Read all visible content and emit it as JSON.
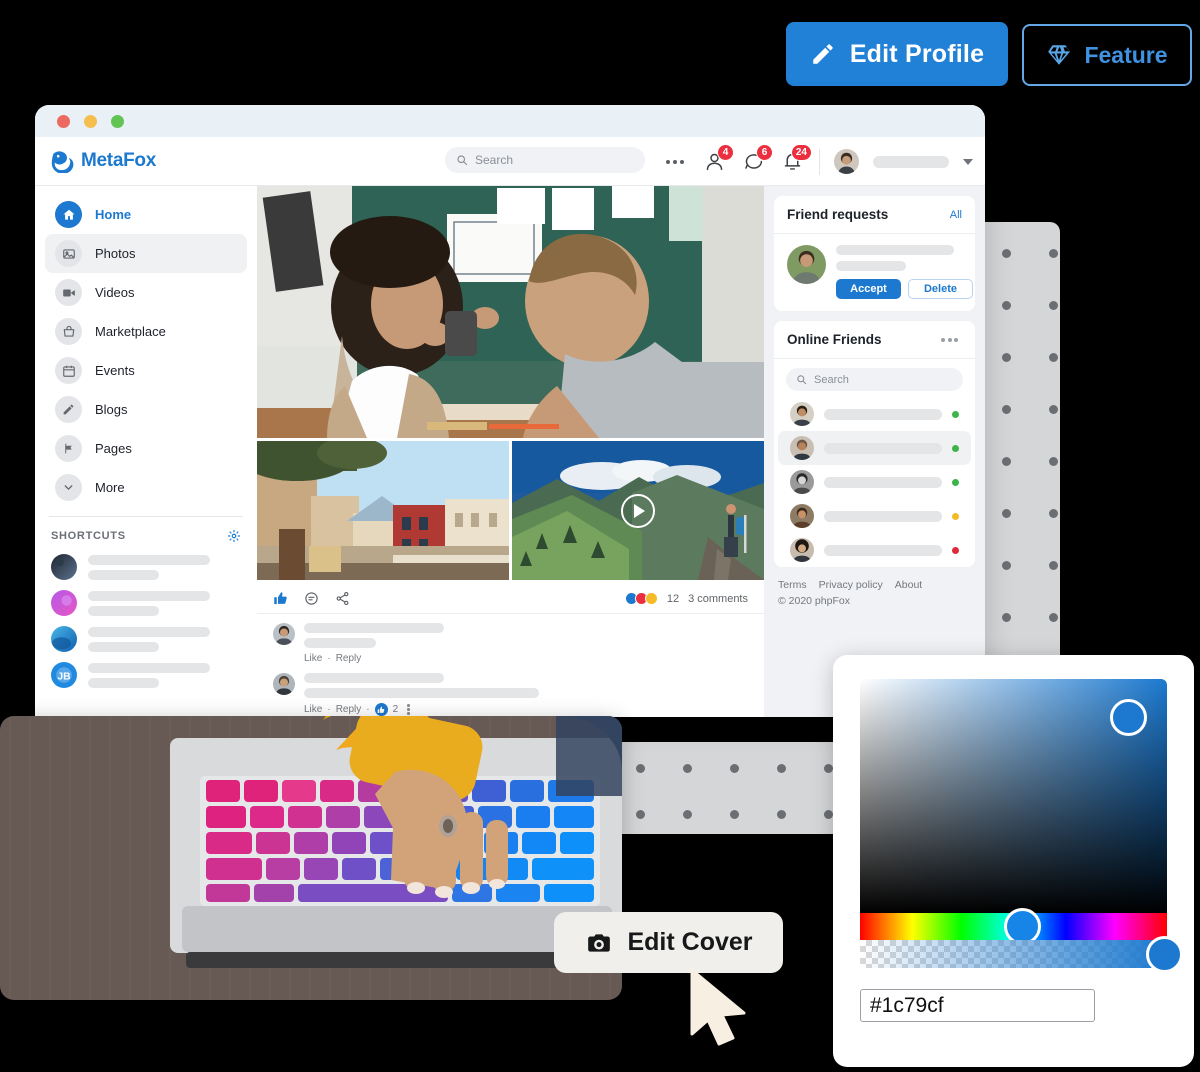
{
  "top_actions": {
    "edit_profile": {
      "label": "Edit Profile",
      "icon": "pencil-icon",
      "color": "#2081d6"
    },
    "feature": {
      "label": "Feature",
      "icon": "diamond-icon",
      "color": "#3f92e0"
    }
  },
  "window": {
    "traffic_lights": [
      "close",
      "minimize",
      "maximize"
    ]
  },
  "appbar": {
    "brand": "MetaFox",
    "brand_color": "#1c79cf",
    "search": {
      "placeholder": "Search",
      "icon": "search-icon"
    },
    "more_icon": "ellipsis-icon",
    "icons": [
      {
        "name": "friends-icon",
        "badge": "4"
      },
      {
        "name": "messages-icon",
        "badge": "6"
      },
      {
        "name": "notifications-icon",
        "badge": "24"
      }
    ],
    "account": {
      "avatar": "user-avatar",
      "caret": "chevron-down-icon"
    }
  },
  "sidebar": {
    "items": [
      {
        "label": "Home",
        "icon": "home-icon",
        "active": true
      },
      {
        "label": "Photos",
        "icon": "photo-icon",
        "highlighted": true
      },
      {
        "label": "Videos",
        "icon": "video-icon"
      },
      {
        "label": "Marketplace",
        "icon": "shop-icon"
      },
      {
        "label": "Events",
        "icon": "calendar-icon"
      },
      {
        "label": "Blogs",
        "icon": "pencil-icon"
      },
      {
        "label": "Pages",
        "icon": "flag-icon"
      },
      {
        "label": "More",
        "icon": "chevron-down-icon"
      }
    ],
    "shortcuts_title": "SHORTCUTS",
    "shortcuts_settings_icon": "gear-icon",
    "shortcuts": [
      {
        "avatar_colors": [
          "#1f2430",
          "#46566b"
        ]
      },
      {
        "avatar_colors": [
          "#b458e8",
          "#e857c4"
        ]
      },
      {
        "avatar_colors": [
          "#1d6fd0",
          "#49b7e8"
        ]
      },
      {
        "avatar_colors": [
          "#1f8ae0",
          "#0f63b5"
        ]
      }
    ]
  },
  "feed": {
    "hero_alt": "two-people-at-desk-photo",
    "thumb_left_alt": "italian-town-street-photo",
    "thumb_right_alt": "mountain-hiker-video",
    "play_icon": "play-icon",
    "actions": [
      {
        "name": "like-icon"
      },
      {
        "name": "comment-icon"
      },
      {
        "name": "share-icon"
      }
    ],
    "reactions_count": "12",
    "comments_count": "3 comments",
    "comments": [
      {
        "like_label": "Like",
        "reply_label": "Reply",
        "sep": "·"
      },
      {
        "like_label": "Like",
        "reply_label": "Reply",
        "sep": "·",
        "like_count": "2"
      }
    ]
  },
  "friend_requests": {
    "title": "Friend requests",
    "all_label": "All",
    "accept_label": "Accept",
    "delete_label": "Delete"
  },
  "online_friends": {
    "title": "Online Friends",
    "more_icon": "ellipsis-icon",
    "search_placeholder": "Search",
    "rows": [
      {
        "status": "#3cb44a",
        "highlighted": false
      },
      {
        "status": "#3cb44a",
        "highlighted": true
      },
      {
        "status": "#3cb44a",
        "highlighted": false
      },
      {
        "status": "#f5ba28",
        "highlighted": false
      },
      {
        "status": "#e0293a",
        "highlighted": false
      }
    ]
  },
  "footer": {
    "links": [
      "Terms",
      "Privacy policy",
      "About"
    ],
    "copyright": "© 2020 phpFox"
  },
  "cover": {
    "alt": "hands-typing-on-laptop-photo",
    "edit_button": {
      "label": "Edit Cover",
      "icon": "camera-icon"
    },
    "cursor": "cursor-arrow-icon"
  },
  "color_picker": {
    "hex_value": "#1c79cf",
    "selected_color": "#1c79cf",
    "sv_handle": "saturation-value-handle",
    "hue_handle": "hue-handle",
    "alpha_handle": "alpha-handle"
  }
}
